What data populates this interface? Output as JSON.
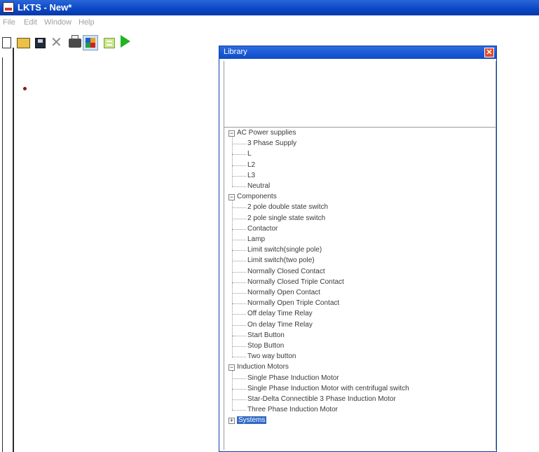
{
  "window": {
    "title": "LKTS - New*"
  },
  "menu": [
    "File",
    "Edit",
    "Window",
    "Help"
  ],
  "toolbar": {
    "icons": [
      "new-file-icon",
      "open-folder-icon",
      "save-disk-icon",
      "delete-x-icon",
      "print-icon",
      "library-icon",
      "list-icon",
      "run-play-icon"
    ]
  },
  "library": {
    "title": "Library",
    "close_glyph": "✕",
    "tree": [
      {
        "label": "AC Power supplies",
        "expanded": true,
        "children": [
          "3 Phase Supply",
          "L",
          "L2",
          "L3",
          "Neutral"
        ]
      },
      {
        "label": "Components",
        "expanded": true,
        "children": [
          "2 pole double state switch",
          "2 pole single state switch",
          "Contactor",
          "Lamp",
          "Limit switch(single pole)",
          "Limit switch(two pole)",
          "Normally Closed Contact",
          "Normally Closed Triple Contact",
          "Normally Open Contact",
          "Normally Open Triple Contact",
          "Off delay Time Relay",
          "On delay Time Relay",
          "Start Button",
          "Stop Button",
          "Two way button"
        ]
      },
      {
        "label": "Induction Motors",
        "expanded": true,
        "children": [
          "Single Phase Induction Motor",
          "Single Phase Induction Motor with centrifugal switch",
          "Star-Delta Connectible 3 Phase Induction Motor",
          "Three Phase Induction Motor"
        ]
      },
      {
        "label": "Systems",
        "expanded": false,
        "selected": true,
        "children": []
      }
    ]
  }
}
